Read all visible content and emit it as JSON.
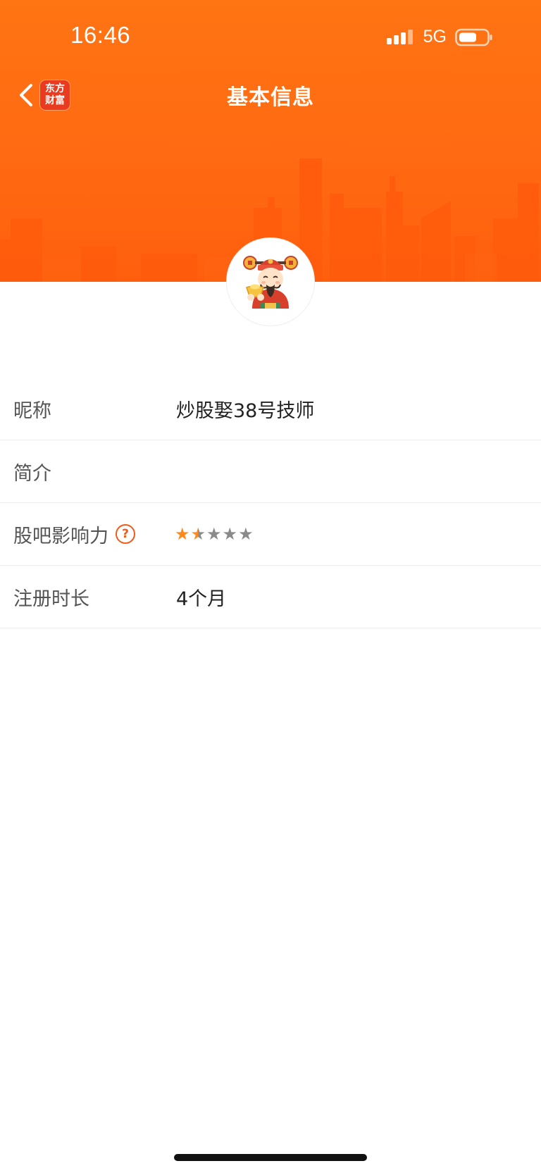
{
  "status_bar": {
    "time": "16:46",
    "network": "5G",
    "signal_icon": "cellular-signal-icon",
    "battery_icon": "battery-icon"
  },
  "nav": {
    "back_icon": "chevron-left-icon",
    "logo_line1": "东方",
    "logo_line2": "财富",
    "title": "基本信息"
  },
  "avatar": {
    "icon": "caishen-avatar-icon"
  },
  "profile": {
    "nickname_label": "昵称",
    "nickname_value": "炒股娶38号技师",
    "bio_label": "简介",
    "bio_value": "",
    "influence_label": "股吧影响力",
    "influence_help_icon": "question-circle-icon",
    "influence_help_glyph": "?",
    "influence_rating": 1.5,
    "influence_max": 5,
    "registration_label": "注册时长",
    "registration_value": "4个月"
  },
  "colors": {
    "header_orange": "#ff6a12",
    "star_active": "#ff8a1c",
    "star_inactive": "#8a8a8a",
    "help_icon": "#f05a1a"
  }
}
